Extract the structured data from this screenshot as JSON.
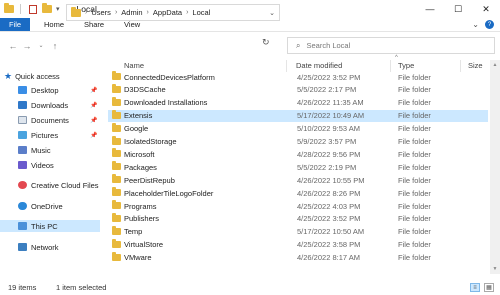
{
  "window": {
    "title": "Local",
    "minimize": "—",
    "maximize": "☐",
    "close": "✕"
  },
  "ribbon": {
    "file": "File",
    "tabs": [
      "Home",
      "Share",
      "View"
    ]
  },
  "address": {
    "crumbs": [
      "This PC",
      "Users",
      "Admin",
      "AppData",
      "Local"
    ]
  },
  "search": {
    "placeholder": "Search Local"
  },
  "sidebar": {
    "items": [
      {
        "label": "Quick access",
        "icon": "star-icon"
      },
      {
        "label": "Desktop",
        "icon": "desktop-icon"
      },
      {
        "label": "Downloads",
        "icon": "download-icon"
      },
      {
        "label": "Documents",
        "icon": "document-icon"
      },
      {
        "label": "Pictures",
        "icon": "picture-icon"
      },
      {
        "label": "Music",
        "icon": "music-icon"
      },
      {
        "label": "Videos",
        "icon": "video-icon"
      },
      {
        "label": "Creative Cloud Files",
        "icon": "creative-cloud-icon"
      },
      {
        "label": "OneDrive",
        "icon": "cloud-icon"
      },
      {
        "label": "This PC",
        "icon": "computer-icon"
      },
      {
        "label": "Network",
        "icon": "network-icon"
      }
    ]
  },
  "columns": {
    "name": "Name",
    "date": "Date modified",
    "type": "Type",
    "size": "Size"
  },
  "files": [
    {
      "name": "ConnectedDevicesPlatform",
      "date": "4/25/2022 3:52 PM",
      "type": "File folder"
    },
    {
      "name": "D3DSCache",
      "date": "5/5/2022 2:17 PM",
      "type": "File folder"
    },
    {
      "name": "Downloaded Installations",
      "date": "4/26/2022 11:35 AM",
      "type": "File folder"
    },
    {
      "name": "Extensis",
      "date": "5/17/2022 10:49 AM",
      "type": "File folder"
    },
    {
      "name": "Google",
      "date": "5/10/2022 9:53 AM",
      "type": "File folder"
    },
    {
      "name": "IsolatedStorage",
      "date": "5/9/2022 3:57 PM",
      "type": "File folder"
    },
    {
      "name": "Microsoft",
      "date": "4/28/2022 9:56 PM",
      "type": "File folder"
    },
    {
      "name": "Packages",
      "date": "5/5/2022 2:19 PM",
      "type": "File folder"
    },
    {
      "name": "PeerDistRepub",
      "date": "4/26/2022 10:55 PM",
      "type": "File folder"
    },
    {
      "name": "PlaceholderTileLogoFolder",
      "date": "4/26/2022 8:26 PM",
      "type": "File folder"
    },
    {
      "name": "Programs",
      "date": "4/25/2022 4:03 PM",
      "type": "File folder"
    },
    {
      "name": "Publishers",
      "date": "4/25/2022 3:52 PM",
      "type": "File folder"
    },
    {
      "name": "Temp",
      "date": "5/17/2022 10:50 AM",
      "type": "File folder"
    },
    {
      "name": "VirtualStore",
      "date": "4/25/2022 3:58 PM",
      "type": "File folder"
    },
    {
      "name": "VMware",
      "date": "4/26/2022 8:17 AM",
      "type": "File folder"
    }
  ],
  "status": {
    "count": "19 items",
    "selected": "1 item selected"
  },
  "colors": {
    "accent": "#1a6bc4",
    "selection": "#cce8ff",
    "folder": "#e8b93c"
  }
}
